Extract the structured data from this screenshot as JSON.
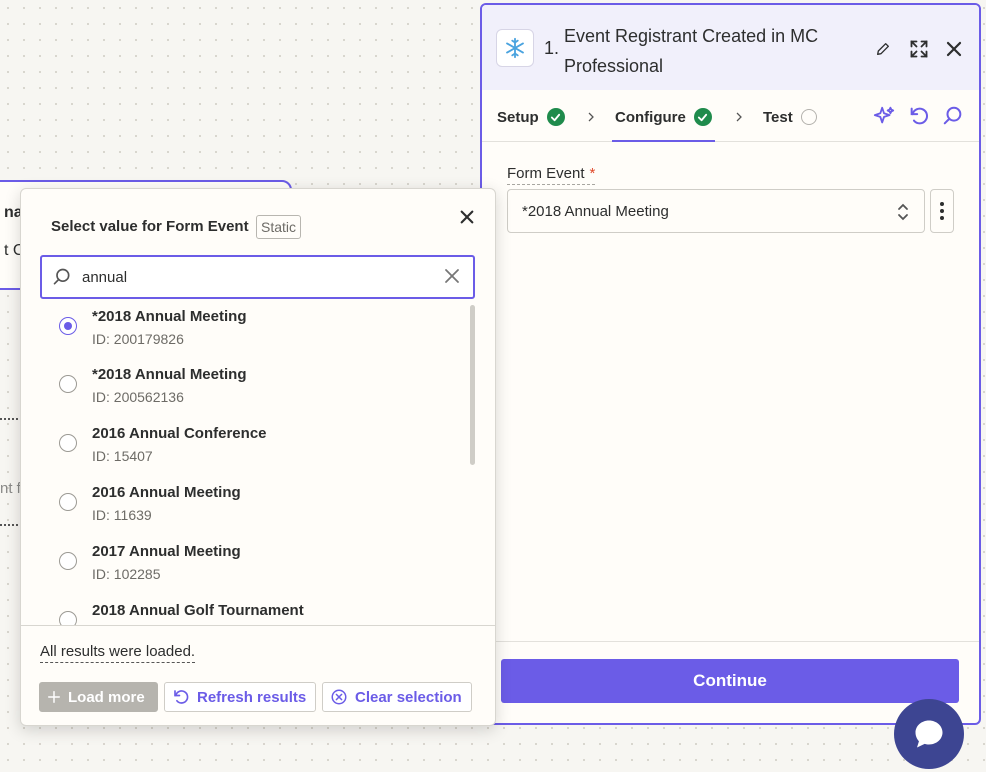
{
  "background": {
    "card_line1": "na",
    "card_line2": "t C",
    "fragment": "nt f"
  },
  "step": {
    "number": "1.",
    "title": "Event Registrant Created in MC Professional",
    "app_icon": "snowflake-icon",
    "actions": [
      "pencil-icon",
      "expand-icon",
      "close-icon"
    ]
  },
  "tabs": [
    {
      "label": "Setup",
      "status": "complete"
    },
    {
      "label": "Configure",
      "status": "complete",
      "active": true
    },
    {
      "label": "Test",
      "status": "pending"
    }
  ],
  "tools": [
    "sparkle-icon",
    "undo-icon",
    "search-icon"
  ],
  "form": {
    "field_label": "Form Event",
    "required_mark": "*",
    "selected_value": "*2018 Annual Meeting"
  },
  "continue_label": "Continue",
  "dropdown": {
    "title": "Select value for Form Event",
    "badge": "Static",
    "search_value": "annual",
    "results": [
      {
        "name": "*2018 Annual Meeting",
        "id": "ID: 200179826",
        "selected": true
      },
      {
        "name": "*2018 Annual Meeting",
        "id": "ID: 200562136",
        "selected": false
      },
      {
        "name": "2016 Annual Conference",
        "id": "ID: 15407",
        "selected": false
      },
      {
        "name": "2016 Annual Meeting",
        "id": "ID: 11639",
        "selected": false
      },
      {
        "name": "2017 Annual Meeting",
        "id": "ID: 102285",
        "selected": false
      },
      {
        "name": "2018 Annual Golf Tournament",
        "id": "",
        "selected": false
      }
    ],
    "status_message": "All results were loaded.",
    "load_more_label": "Load more",
    "refresh_label": "Refresh results",
    "clear_label": "Clear selection"
  },
  "colors": {
    "accent": "#6b5ce7",
    "success": "#1f8b4c",
    "chat": "#3d4592"
  }
}
